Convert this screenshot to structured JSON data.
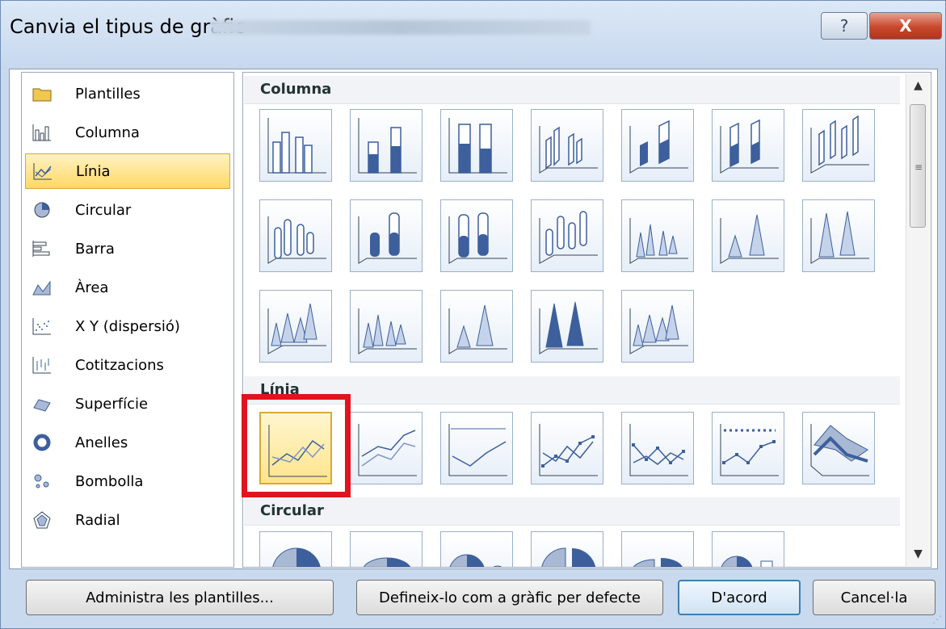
{
  "window": {
    "title": "Canvia el tipus de gràfic",
    "help_icon": "?",
    "close_icon": "X"
  },
  "categories": [
    {
      "label": "Plantilles",
      "icon": "folder-icon"
    },
    {
      "label": "Columna",
      "icon": "column-chart-icon"
    },
    {
      "label": "Línia",
      "icon": "line-chart-icon",
      "selected": true
    },
    {
      "label": "Circular",
      "icon": "pie-chart-icon"
    },
    {
      "label": "Barra",
      "icon": "bar-chart-icon"
    },
    {
      "label": "Àrea",
      "icon": "area-chart-icon"
    },
    {
      "label": "X Y (dispersió)",
      "icon": "scatter-chart-icon"
    },
    {
      "label": "Cotitzacions",
      "icon": "stock-chart-icon"
    },
    {
      "label": "Superfície",
      "icon": "surface-chart-icon"
    },
    {
      "label": "Anelles",
      "icon": "doughnut-chart-icon"
    },
    {
      "label": "Bombolla",
      "icon": "bubble-chart-icon"
    },
    {
      "label": "Radial",
      "icon": "radar-chart-icon"
    }
  ],
  "sections": {
    "column": "Columna",
    "line": "Línia",
    "pie": "Circular"
  },
  "buttons": {
    "manage_templates": "Administra les plantilles...",
    "set_default": "Defineix-lo com a gràfic per defecte",
    "ok": "D'acord",
    "cancel": "Cancel·la"
  },
  "colors": {
    "accent": "#d8a838",
    "highlight": "#e0141e",
    "chart_blue": "#3d5f9c"
  }
}
